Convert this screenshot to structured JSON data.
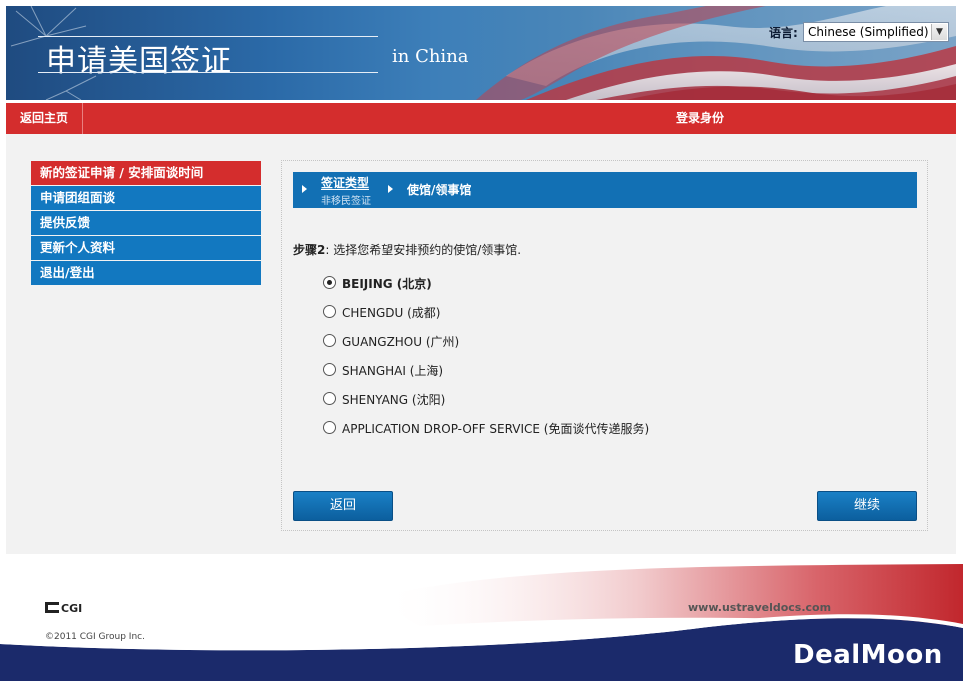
{
  "header": {
    "title": "申请美国签证",
    "subtitle": "in China",
    "language_label": "语言:",
    "language_selected": "Chinese (Simplified)"
  },
  "nav": {
    "home": "返回主页",
    "login_status": "登录身份"
  },
  "sidebar": {
    "items": [
      {
        "label": "新的签证申请 / 安排面谈时间",
        "active": true
      },
      {
        "label": "申请团组面谈",
        "active": false
      },
      {
        "label": "提供反馈",
        "active": false
      },
      {
        "label": "更新个人资料",
        "active": false
      },
      {
        "label": "退出/登出",
        "active": false
      }
    ]
  },
  "breadcrumb": {
    "step1_title": "签证类型",
    "step1_sub": "非移民签证",
    "step2_title": "使馆/领事馆"
  },
  "instruction": {
    "step": "步骤2",
    "text": ": 选择您希望安排预约的使馆/领事馆."
  },
  "posts": [
    {
      "label": "BEIJING (北京)",
      "selected": true
    },
    {
      "label": "CHENGDU (成都)",
      "selected": false
    },
    {
      "label": "GUANGZHOU (广州)",
      "selected": false
    },
    {
      "label": "SHANGHAI (上海)",
      "selected": false
    },
    {
      "label": "SHENYANG (沈阳)",
      "selected": false
    },
    {
      "label": "APPLICATION DROP-OFF SERVICE (免面谈代传递服务)",
      "selected": false
    }
  ],
  "buttons": {
    "back": "返回",
    "continue": "继续"
  },
  "footer": {
    "logo": "CGI",
    "copyright": "©2011 CGI Group Inc.",
    "url": "www.ustraveldocs.com",
    "watermark": "DealMoon"
  },
  "colors": {
    "red": "#d42d2d",
    "blue": "#1278c0",
    "navy": "#1b2a6b"
  }
}
